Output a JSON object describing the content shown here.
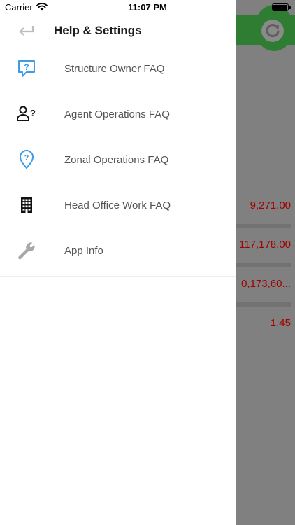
{
  "status_bar": {
    "carrier": "Carrier",
    "time": "11:07 PM"
  },
  "drawer": {
    "title": "Help & Settings",
    "items": [
      {
        "label": "Structure Owner FAQ",
        "icon": "chat-question-icon"
      },
      {
        "label": "Agent Operations FAQ",
        "icon": "person-question-icon"
      },
      {
        "label": "Zonal Operations FAQ",
        "icon": "location-question-icon"
      },
      {
        "label": "Head Office Work FAQ",
        "icon": "building-icon"
      },
      {
        "label": "App Info",
        "icon": "wrench-icon"
      }
    ]
  },
  "background": {
    "values": [
      "9,271.00",
      "117,178.00",
      "0,173,60...",
      "1.45"
    ]
  },
  "colors": {
    "accent_blue": "#3d9be9",
    "header_green": "#2e7d32",
    "value_red": "#a30000",
    "overlay_gray": "#808080"
  }
}
